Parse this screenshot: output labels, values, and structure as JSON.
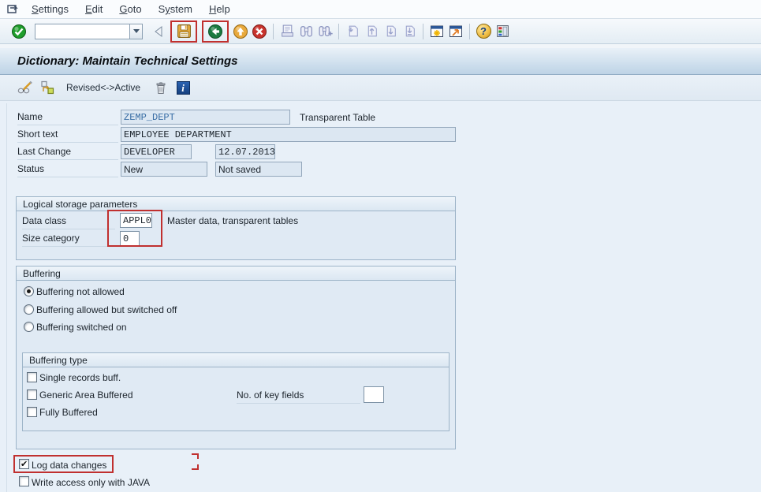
{
  "colors": {
    "annotation_red": "#c0302f",
    "field_value_blue": "#3a6ea5",
    "titlebar_gradient_top": "#e9f1f8",
    "titlebar_gradient_bottom": "#bdd3e6",
    "content_background": "#e8f0f8"
  },
  "menu": {
    "items": [
      {
        "pre": "",
        "key": "S",
        "post": "ettings"
      },
      {
        "pre": "",
        "key": "E",
        "post": "dit"
      },
      {
        "pre": "",
        "key": "G",
        "post": "oto"
      },
      {
        "pre": "S",
        "key": "y",
        "post": "stem"
      },
      {
        "pre": "",
        "key": "H",
        "post": "elp"
      }
    ]
  },
  "toolbar": {
    "command_value": "",
    "help_glyph": "?",
    "info_glyph": "i"
  },
  "titlebar": {
    "title": "Dictionary: Maintain Technical Settings"
  },
  "app_toolbar": {
    "revised_active": "Revised<->Active"
  },
  "form": {
    "name_label": "Name",
    "name_value": "ZEMP_DEPT",
    "name_type": "Transparent Table",
    "short_text_label": "Short text",
    "short_text_value": "EMPLOYEE DEPARTMENT",
    "last_change_label": "Last Change",
    "last_change_user": "DEVELOPER",
    "last_change_date": "12.07.2013",
    "status_label": "Status",
    "status_value": "New",
    "status_save": "Not saved"
  },
  "logical_storage": {
    "title": "Logical storage parameters",
    "data_class_label": "Data class",
    "data_class_value": "APPL0",
    "data_class_desc": "Master data, transparent tables",
    "size_category_label": "Size category",
    "size_category_value": "0"
  },
  "buffering": {
    "title": "Buffering",
    "options": [
      {
        "label": "Buffering not allowed",
        "selected": true
      },
      {
        "label": "Buffering allowed but switched off",
        "selected": false
      },
      {
        "label": "Buffering switched on",
        "selected": false
      }
    ],
    "type_group": {
      "title": "Buffering type",
      "items": [
        {
          "label": "Single records buff.",
          "checked": false
        },
        {
          "label": "Generic Area Buffered",
          "checked": false
        },
        {
          "label": "Fully Buffered",
          "checked": false
        }
      ],
      "key_fields_label": "No. of key fields",
      "key_fields_value": ""
    }
  },
  "footer": {
    "log_data_changes": {
      "label": "Log data changes",
      "checked": true
    },
    "java_access": {
      "label": "Write access only with JAVA",
      "checked": false
    }
  }
}
